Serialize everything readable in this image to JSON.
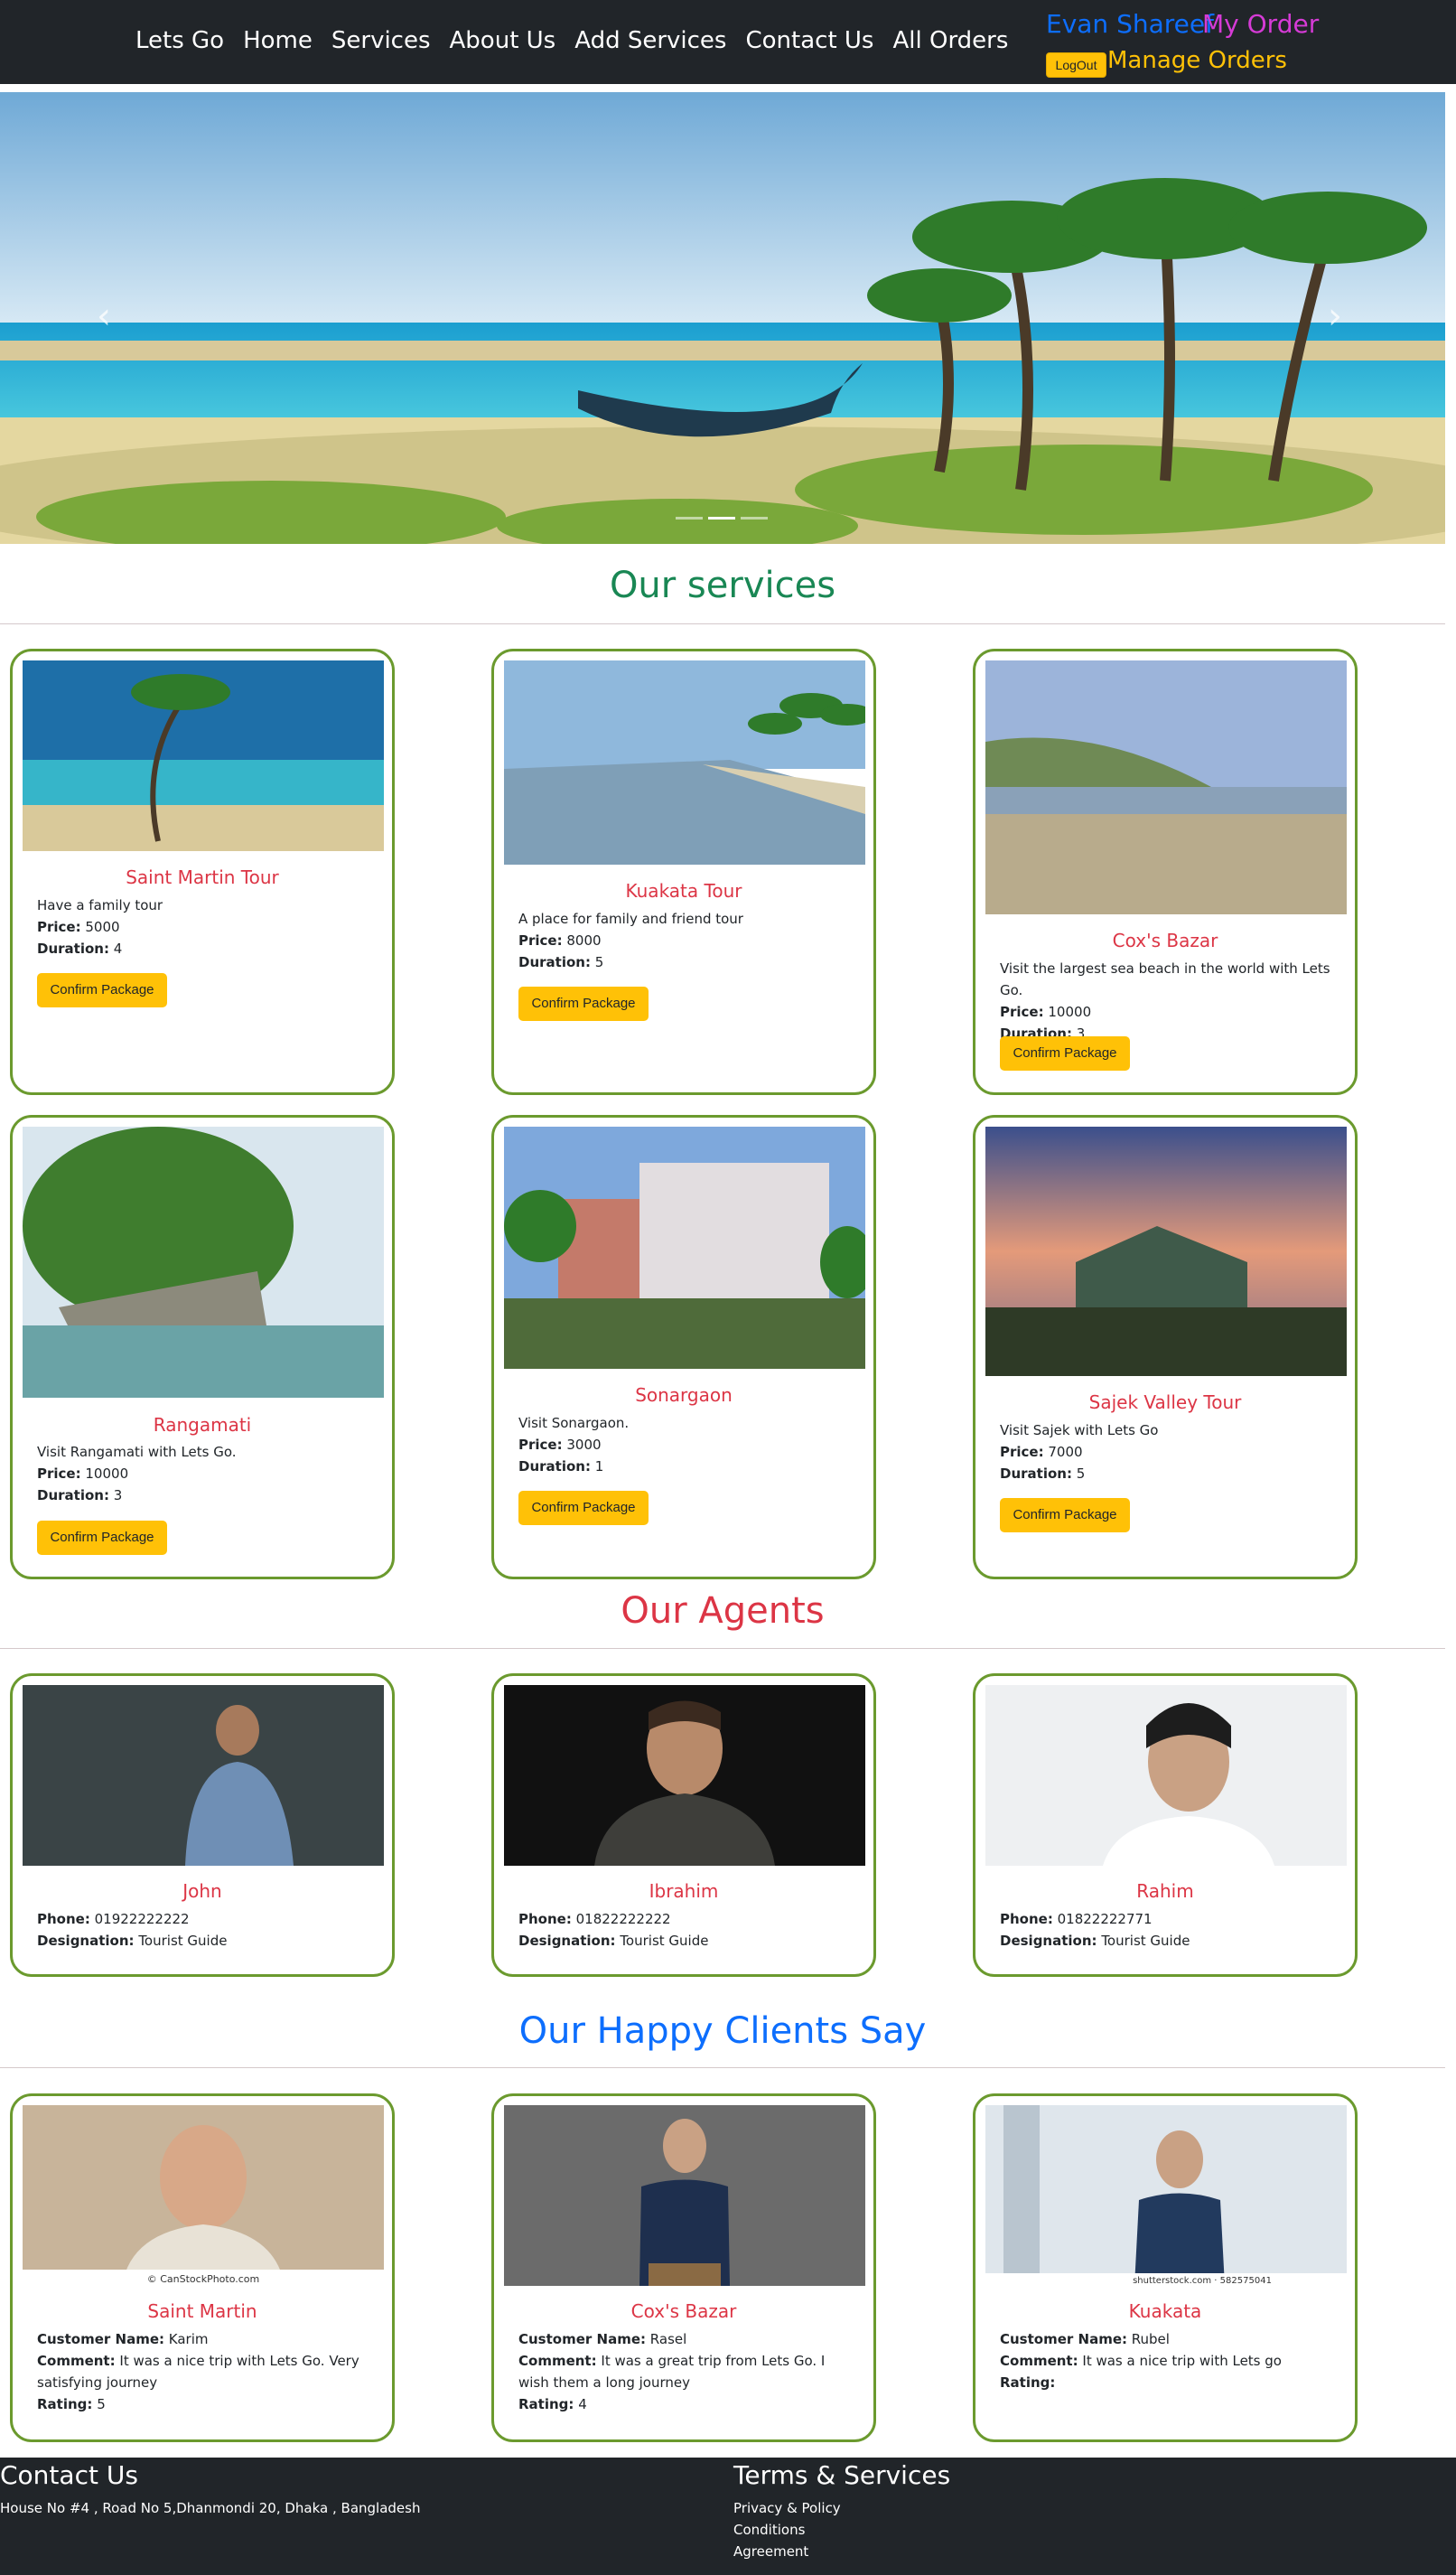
{
  "nav": {
    "links": [
      "Lets Go",
      "Home",
      "Services",
      "About Us",
      "Add Services",
      "Contact Us",
      "All Orders"
    ],
    "user_name": "Evan Shareef",
    "my_order": "My Order",
    "logout": "LogOut",
    "manage_orders": "Manage Orders"
  },
  "hero": {
    "prev": "‹",
    "next": "›",
    "indicator_count": 3,
    "active_indicator": 1
  },
  "services": {
    "title": "Our services",
    "items": [
      {
        "title": "Saint Martin Tour",
        "description": "Have a family tour",
        "price_label": "Price:",
        "price": "5000",
        "duration_label": "Duration:",
        "duration": "4",
        "button": "Confirm Package"
      },
      {
        "title": "Kuakata Tour",
        "description": "A place for family and friend tour",
        "price_label": "Price:",
        "price": "8000",
        "duration_label": "Duration:",
        "duration": "5",
        "button": "Confirm Package"
      },
      {
        "title": "Cox's Bazar",
        "description": "Visit the largest sea beach in the world with Lets Go.",
        "price_label": "Price:",
        "price": "10000",
        "duration_label": "Duration:",
        "duration": "3",
        "button": "Confirm Package"
      },
      {
        "title": "Rangamati",
        "description": "Visit Rangamati with Lets Go.",
        "price_label": "Price:",
        "price": "10000",
        "duration_label": "Duration:",
        "duration": "3",
        "button": "Confirm Package"
      },
      {
        "title": "Sonargaon",
        "description": "Visit Sonargaon.",
        "price_label": "Price:",
        "price": "3000",
        "duration_label": "Duration:",
        "duration": "1",
        "button": "Confirm Package"
      },
      {
        "title": "Sajek Valley Tour",
        "description": "Visit Sajek with Lets Go",
        "price_label": "Price:",
        "price": "7000",
        "duration_label": "Duration:",
        "duration": "5",
        "button": "Confirm Package"
      }
    ]
  },
  "agents": {
    "title": "Our Agents",
    "items": [
      {
        "name": "John",
        "phone_label": "Phone:",
        "phone": "01922222222",
        "designation_label": "Designation:",
        "designation": "Tourist Guide"
      },
      {
        "name": "Ibrahim",
        "phone_label": "Phone:",
        "phone": "01822222222",
        "designation_label": "Designation:",
        "designation": "Tourist Guide"
      },
      {
        "name": "Rahim",
        "phone_label": "Phone:",
        "phone": "01822222771",
        "designation_label": "Designation:",
        "designation": "Tourist Guide"
      }
    ]
  },
  "clients": {
    "title": "Our Happy Clients Say",
    "items": [
      {
        "place": "Saint Martin",
        "watermark": "© CanStockPhoto.com",
        "name_label": "Customer Name:",
        "name": "Karim",
        "comment_label": "Comment:",
        "comment": "It was a nice trip with Lets Go. Very satisfying journey",
        "rating_label": "Rating:",
        "rating": "5"
      },
      {
        "place": "Cox's Bazar",
        "watermark": "",
        "name_label": "Customer Name:",
        "name": "Rasel",
        "comment_label": "Comment:",
        "comment": "It was a great trip from Lets Go. I wish them a long journey",
        "rating_label": "Rating:",
        "rating": "4"
      },
      {
        "place": "Kuakata",
        "watermark": "shutterstock.com · 582575041",
        "name_label": "Customer Name:",
        "name": "Rubel",
        "comment_label": "Comment:",
        "comment": "It was a nice trip with Lets go",
        "rating_label": "Rating:",
        "rating": ""
      }
    ]
  },
  "footer": {
    "contact_title": "Contact Us",
    "address": "House No #4 , Road No 5,Dhanmondi 20, Dhaka , Bangladesh",
    "terms_title": "Terms & Services",
    "terms_links": [
      "Privacy & Policy",
      "Conditions",
      "Agreement"
    ]
  },
  "colors": {
    "navbar_bg": "#212529",
    "card_border": "#6b9a2e",
    "card_title": "#dc3545",
    "button": "#ffc107",
    "services_title": "#198754",
    "agents_title": "#dc3545",
    "clients_title": "#0d6efd"
  }
}
